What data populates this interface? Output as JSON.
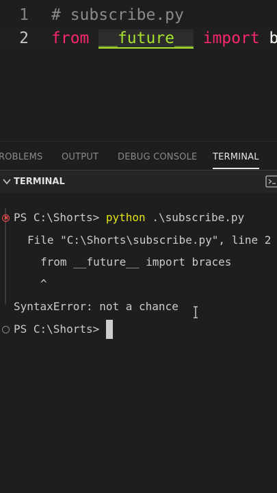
{
  "editor": {
    "lines": [
      {
        "number": "1",
        "comment": "# subscribe.py"
      },
      {
        "number": "2",
        "keyword_from": "from",
        "module": "__future__",
        "keyword_import": "import",
        "rest": "b"
      }
    ]
  },
  "panel": {
    "tabs": [
      {
        "label": "ROBLEMS"
      },
      {
        "label": "OUTPUT"
      },
      {
        "label": "DEBUG CONSOLE"
      },
      {
        "label": "TERMINAL",
        "active": true
      }
    ],
    "header_title": "TERMINAL"
  },
  "terminal": {
    "prompt1": "PS C:\\Shorts>",
    "command": "python",
    "command_arg": ".\\subscribe.py",
    "traceback_file": "File \"C:\\Shorts\\subscribe.py\", line 2",
    "traceback_code": "from __future__ import braces",
    "traceback_caret": "^",
    "error": "SyntaxError: not a chance",
    "prompt2": "PS C:\\Shorts>"
  },
  "colors": {
    "keyword": "#f92672",
    "module": "#a6e22e",
    "command": "#e5e510",
    "error_icon": "#f14c4c"
  }
}
